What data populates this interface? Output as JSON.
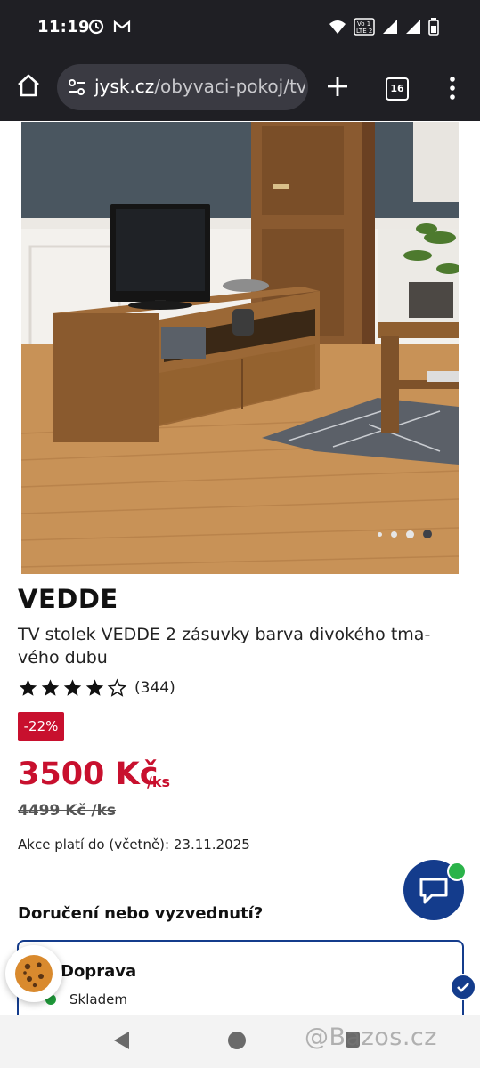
{
  "status_bar": {
    "time": "11:19",
    "notification_icons": [
      "sync-icon",
      "gmail-icon"
    ],
    "system_icons": [
      "wifi-icon",
      "volte-icon",
      "signal-icon",
      "signal-icon",
      "battery-icon"
    ]
  },
  "browser": {
    "url_host": "jysk.cz",
    "url_path": "/obyvaci-pokoj/tv",
    "tab_count": "16"
  },
  "gallery": {
    "image_count": 4,
    "active_index": 3
  },
  "product": {
    "brand": "VEDDE",
    "name": "TV stolek VEDDE 2 zásuvky barva divokého tma- vého dubu",
    "rating_stars": 4,
    "rating_max": 5,
    "review_count": "(344)",
    "discount_badge": "-22%",
    "price": "3500 Kč",
    "price_unit": "/ks",
    "old_price": "4499 Kč /ks",
    "promo_text": "Akce platí do (včetně): 23.11.2025"
  },
  "delivery": {
    "title": "Doručení nebo vyzvednutí?",
    "option_label": "Doprava",
    "stock_status": "Skladem"
  },
  "watermark": "@Bazos.cz",
  "colors": {
    "accent_red": "#c8102e",
    "brand_blue": "#143c8c",
    "stock_green": "#1f9a3a",
    "chrome_bar": "#1f1f24"
  }
}
